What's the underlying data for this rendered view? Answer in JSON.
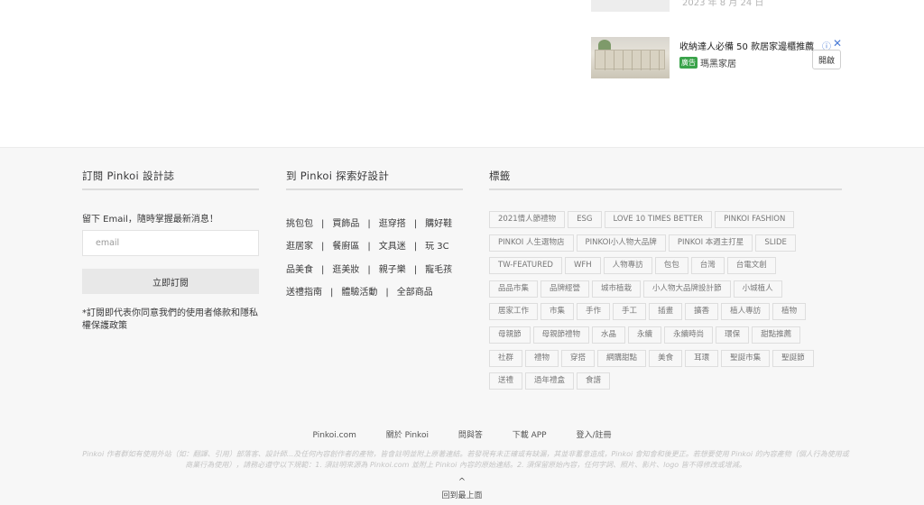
{
  "related": {
    "top_date": "2023 年 8 月 24 日"
  },
  "ad": {
    "title": "收納達人必備 50 款居家邊櫃推薦",
    "badge": "廣告",
    "brand": "瑪黑家居",
    "open_label": "開啟",
    "info_icon": "ⓘ",
    "close_icon": "✕"
  },
  "footer": {
    "subscribe": {
      "heading": "訂閱 Pinkoi 設計誌",
      "intro": "留下 Email，隨時掌握最新消息！",
      "email_placeholder": "email",
      "button_label": "立即訂閱",
      "terms": "*訂閱即代表你同意我們的使用者條款和隱私權保護政策"
    },
    "explore": {
      "heading": "到 Pinkoi 探索好設計",
      "rows": [
        [
          "挑包包",
          "買飾品",
          "逛穿搭",
          "購好鞋"
        ],
        [
          "逛居家",
          "餐廚區",
          "文具迷",
          "玩 3C"
        ],
        [
          "品美食",
          "逛美妝",
          "親子樂",
          "寵毛孩"
        ],
        [
          "送禮指南",
          "體驗活動",
          "全部商品"
        ]
      ]
    },
    "tags": {
      "heading": "標籤",
      "rows": [
        [
          "2021情人節禮物",
          "ESG",
          "LOVE 10 TIMES BETTER",
          "PINKOI FASHION"
        ],
        [
          "PINKOI 人生選物店",
          "PINKOI小人物大品牌",
          "PINKOI 本週主打星",
          "SLIDE"
        ],
        [
          "TW-FEATURED",
          "WFH",
          "人物專訪",
          "包包",
          "台灣",
          "台電文創"
        ],
        [
          "品品市集",
          "品牌經營",
          "城市植栽",
          "小人物大品牌設計節",
          "小城植人"
        ],
        [
          "居家工作",
          "市集",
          "手作",
          "手工",
          "插畫",
          "擴香",
          "植人專訪",
          "植物"
        ],
        [
          "母親節",
          "母親節禮物",
          "水晶",
          "永續",
          "永續時尚",
          "環保",
          "甜點推薦"
        ],
        [
          "社群",
          "禮物",
          "穿搭",
          "網購甜點",
          "美食",
          "耳環",
          "聖誕市集",
          "聖誕節"
        ],
        [
          "送禮",
          "過年禮盒",
          "食譜"
        ]
      ]
    },
    "bottom_links": [
      "Pinkoi.com",
      "關於 Pinkoi",
      "問與答",
      "下載 APP",
      "登入/註冊"
    ],
    "disclaimer": "Pinkoi 作者群如有使用外站（如：翻譯、引用）部落客、設計師...及任何內容創作者的產物，皆會註明並附上原著連結。若發現有未正確或有缺漏，其並非蓄意造成，Pinkoi 會知會和後更正。若想要使用 Pinkoi 的內容產物（個人行為使用或商業行為使用），請務必遵守以下規範：1. 須註明來源為 Pinkoi.com 並附上 Pinkoi 內容的原始連結。2. 須保留原始內容，任何字詞、照片、影片、logo 皆不得修改或增減。",
    "back_to_top": "回到最上面",
    "back_to_top_icon": "^"
  }
}
